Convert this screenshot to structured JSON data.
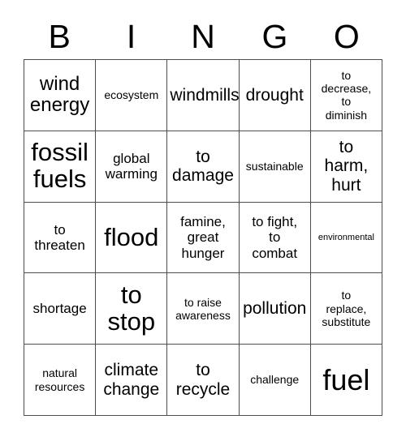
{
  "card": {
    "type": "bingo-card",
    "topic": "environment and climate vocabulary",
    "columns": 5,
    "rows": 5,
    "background_color": "#ffffff",
    "border_color": "#4d4d4d",
    "text_color": "#000000"
  },
  "header": {
    "letters": [
      "B",
      "I",
      "N",
      "G",
      "O"
    ]
  },
  "grid": {
    "rows": [
      [
        {
          "text": "wind\nenergy",
          "size": "l"
        },
        {
          "text": "ecosystem",
          "size": "xs"
        },
        {
          "text": "windmills",
          "size": "m"
        },
        {
          "text": "drought",
          "size": "m"
        },
        {
          "text": "to\ndecrease,\nto\ndiminish",
          "size": "xs"
        }
      ],
      [
        {
          "text": "fossil\nfuels",
          "size": "xl"
        },
        {
          "text": "global\nwarming",
          "size": "s"
        },
        {
          "text": "to\ndamage",
          "size": "m"
        },
        {
          "text": "sustainable",
          "size": "xs"
        },
        {
          "text": "to\nharm,\nhurt",
          "size": "m"
        }
      ],
      [
        {
          "text": "to\nthreaten",
          "size": "s"
        },
        {
          "text": "flood",
          "size": "xl"
        },
        {
          "text": "famine,\ngreat\nhunger",
          "size": "s"
        },
        {
          "text": "to fight,\nto\ncombat",
          "size": "s"
        },
        {
          "text": "environmental",
          "size": "xxs"
        }
      ],
      [
        {
          "text": "shortage",
          "size": "s"
        },
        {
          "text": "to\nstop",
          "size": "xl"
        },
        {
          "text": "to raise\nawareness",
          "size": "xs"
        },
        {
          "text": "pollution",
          "size": "m"
        },
        {
          "text": "to\nreplace,\nsubstitute",
          "size": "xs"
        }
      ],
      [
        {
          "text": "natural\nresources",
          "size": "xs"
        },
        {
          "text": "climate\nchange",
          "size": "m"
        },
        {
          "text": "to\nrecycle",
          "size": "m"
        },
        {
          "text": "challenge",
          "size": "xs"
        },
        {
          "text": "fuel",
          "size": "xxl"
        }
      ]
    ]
  }
}
